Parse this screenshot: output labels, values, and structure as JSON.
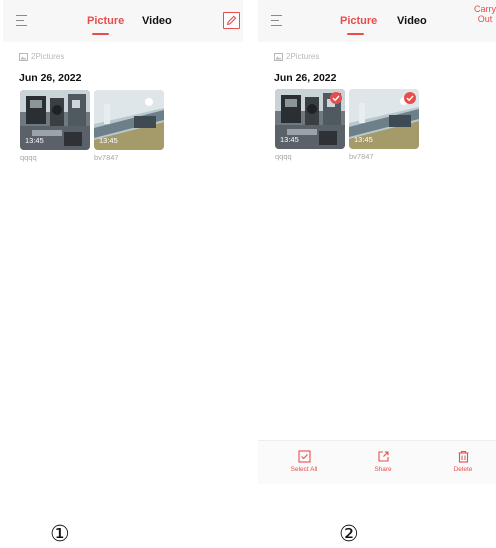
{
  "screens": [
    {
      "tabs": {
        "picture": "Picture",
        "video": "Video"
      },
      "count_label": "2Pictures",
      "date": "Jun 26, 2022",
      "thumbnails": [
        {
          "time": "13:45",
          "name": "qqqq"
        },
        {
          "time": "13:45",
          "name": "bv7847"
        }
      ],
      "edit_icon": "edit-icon",
      "marker": "①"
    },
    {
      "tabs": {
        "picture": "Picture",
        "video": "Video"
      },
      "action_label": "Carry Out",
      "count_label": "2Pictures",
      "date": "Jun 26, 2022",
      "thumbnails": [
        {
          "time": "13:45",
          "name": "qqqq",
          "selected": true
        },
        {
          "time": "13:45",
          "name": "bv7847",
          "selected": true
        }
      ],
      "bottom_actions": {
        "select_all": "Select All",
        "share": "Share",
        "delete": "Delete"
      },
      "marker": "②"
    }
  ],
  "colors": {
    "accent": "#e84d4d",
    "header_bg": "#f7f7f7",
    "muted_text": "#a8a8a8"
  }
}
